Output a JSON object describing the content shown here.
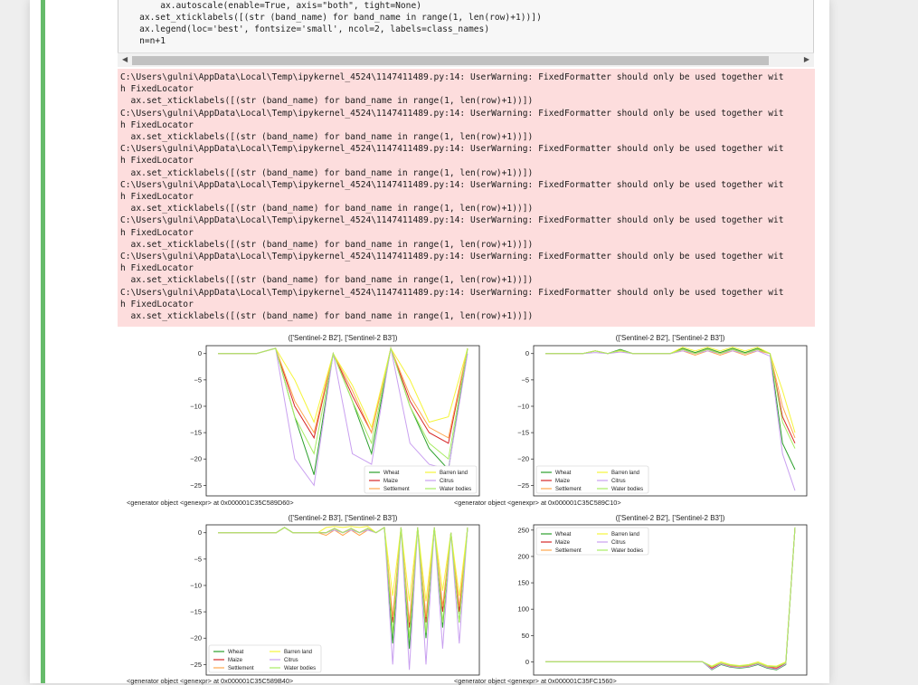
{
  "code": {
    "lines": [
      "        ax.autoscale(enable=True, axis=\"both\", tight=None)",
      "    ax.set_xticklabels([(str (band_name) for band_name in range(1, len(row)+1))])",
      "    ax.legend(loc='best', fontsize='small', ncol=2, labels=class_names)",
      "    n=n+1"
    ]
  },
  "stderr": {
    "warning_line_1": "C:\\Users\\gulni\\AppData\\Local\\Temp\\ipykernel_4524\\1147411489.py:14: UserWarning: FixedFormatter should only be used together wit",
    "warning_line_2": "h FixedLocator",
    "warning_line_3": "  ax.set_xticklabels([(str (band_name) for band_name in range(1, len(row)+1))])",
    "repeat_count": 7
  },
  "colors": {
    "Wheat": "#2ca02c",
    "Maize": "#d62728",
    "Settlement": "#ffa64d",
    "Barren land": "#f5f53b",
    "Citrus": "#c9a0f0",
    "Water bodies": "#a8ec64"
  },
  "chart_data": [
    {
      "type": "line",
      "title": "(['Sentinel-2 B2'], ['Sentinel-2 B3'])",
      "caption": "<generator object <genexpr> at 0x000001C35C589D60>",
      "ylim": [
        -27,
        1.5
      ],
      "yticks": [
        0,
        -5,
        -10,
        -15,
        -20,
        -25
      ],
      "legend": "lower-right",
      "series": [
        {
          "name": "Wheat",
          "values": [
            0,
            0,
            0,
            1,
            -12,
            -23,
            0,
            -9,
            -19,
            1,
            -10,
            -18,
            -22,
            1
          ]
        },
        {
          "name": "Maize",
          "values": [
            0,
            0,
            0,
            1,
            -10,
            -16,
            0,
            -8,
            -15,
            1,
            -9,
            -15,
            -17,
            1
          ]
        },
        {
          "name": "Settlement",
          "values": [
            0,
            0,
            0,
            1,
            -9,
            -15,
            0,
            -7,
            -15,
            1,
            -8,
            -14,
            -16,
            1
          ]
        },
        {
          "name": "Barren land",
          "values": [
            0,
            0,
            0,
            1,
            -5,
            -13,
            0,
            -6,
            -14,
            1,
            -5,
            -13,
            -12,
            1
          ]
        },
        {
          "name": "Citrus",
          "values": [
            0,
            0,
            0,
            1,
            -20,
            -25,
            0,
            -19,
            -21,
            1,
            -17,
            -21,
            -22,
            0
          ]
        },
        {
          "name": "Water bodies",
          "values": [
            0,
            0,
            0,
            1,
            -12,
            -19,
            0,
            -9,
            -17,
            1,
            -10,
            -17,
            -20,
            1
          ]
        }
      ]
    },
    {
      "type": "line",
      "title": "(['Sentinel-2 B2'], ['Sentinel-2 B3'])",
      "caption": "<generator object <genexpr> at 0x000001C35C589C10>",
      "ylim": [
        -27,
        1.5
      ],
      "yticks": [
        0,
        -5,
        -10,
        -15,
        -20,
        -25
      ],
      "legend": "lower-left",
      "series": [
        {
          "name": "Wheat",
          "values": [
            0,
            0,
            0,
            0,
            0.5,
            0,
            0.8,
            0,
            0,
            0,
            0,
            1,
            0.2,
            1,
            0.2,
            1,
            0.2,
            1,
            0,
            -17,
            -22
          ]
        },
        {
          "name": "Maize",
          "values": [
            0,
            0,
            0,
            0,
            0.5,
            0,
            0.6,
            0,
            0,
            0,
            0,
            0.8,
            0,
            0.8,
            0,
            0.8,
            0,
            0.8,
            0,
            -12,
            -17
          ]
        },
        {
          "name": "Settlement",
          "values": [
            0,
            0,
            0,
            0,
            0.5,
            0,
            0.6,
            0,
            0,
            0,
            0,
            0.5,
            -0.3,
            0.5,
            -0.3,
            0.5,
            -0.3,
            0.5,
            0,
            -10,
            -16
          ]
        },
        {
          "name": "Barren land",
          "values": [
            0,
            0,
            0,
            0,
            0.5,
            0,
            0.5,
            0,
            0,
            0,
            0,
            1.2,
            0.5,
            1.2,
            0.5,
            1.2,
            0.5,
            1.2,
            0,
            -7,
            -15
          ]
        },
        {
          "name": "Citrus",
          "values": [
            0,
            0,
            0,
            0,
            0.2,
            0,
            0.3,
            0,
            0,
            0,
            0,
            0.5,
            0,
            0.5,
            0,
            0.5,
            0,
            0.5,
            -0.5,
            -19,
            -26
          ]
        },
        {
          "name": "Water bodies",
          "values": [
            0,
            0,
            0,
            0,
            0.5,
            0,
            0.6,
            0,
            0,
            0,
            0,
            0.8,
            0,
            0.8,
            0,
            0.8,
            0,
            0.8,
            0,
            -13,
            -18
          ]
        }
      ]
    },
    {
      "type": "line",
      "title": "(['Sentinel-2 B3'], ['Sentinel-2 B3'])",
      "caption": "<generator object <genexpr> at 0x000001C35C589B40>",
      "ylim": [
        -27,
        1.5
      ],
      "yticks": [
        0,
        -5,
        -10,
        -15,
        -20,
        -25
      ],
      "legend": "lower-left",
      "series": [
        {
          "name": "Wheat",
          "values": [
            0,
            0,
            0,
            0,
            0,
            0,
            0,
            0,
            1,
            0,
            0,
            0,
            0,
            0,
            0.8,
            0,
            0.8,
            0,
            0.8,
            0,
            1,
            -21,
            1,
            -22,
            1,
            -20,
            1,
            -18,
            0,
            -17,
            1
          ]
        },
        {
          "name": "Maize",
          "values": [
            0,
            0,
            0,
            0,
            0,
            0,
            0,
            0,
            1,
            0,
            0,
            0,
            0,
            0,
            0.8,
            0,
            0.8,
            0,
            0.8,
            0,
            1,
            -17,
            1,
            -18,
            1,
            -17,
            1,
            -15,
            0,
            -15,
            1
          ]
        },
        {
          "name": "Settlement",
          "values": [
            0,
            0,
            0,
            0,
            0,
            0,
            0,
            0,
            1,
            0,
            0,
            0,
            0,
            -0.5,
            0.5,
            -0.5,
            0.5,
            -0.5,
            0.5,
            0,
            1,
            -16,
            1,
            -17,
            1,
            -16,
            1,
            -14,
            0,
            -14,
            1
          ]
        },
        {
          "name": "Barren land",
          "values": [
            0,
            0,
            0,
            0,
            0,
            0,
            0,
            0,
            1,
            0,
            0,
            0,
            0,
            1,
            1.2,
            1,
            1.2,
            1,
            1.2,
            0,
            1,
            -12,
            1,
            -13,
            1,
            -13,
            1,
            -11,
            0,
            -12,
            1
          ]
        },
        {
          "name": "Citrus",
          "values": [
            0,
            0,
            0,
            0,
            0,
            0,
            0,
            0,
            1,
            0,
            0,
            0,
            0,
            0,
            0.5,
            0,
            0.5,
            0,
            0.5,
            0,
            1,
            -25,
            1,
            -26,
            1,
            -25,
            1,
            -22,
            0,
            -21,
            1
          ]
        },
        {
          "name": "Water bodies",
          "values": [
            0,
            0,
            0,
            0,
            0,
            0,
            0,
            0,
            1,
            0,
            0,
            0,
            0,
            0,
            0.8,
            0,
            0.8,
            0,
            0.8,
            0,
            1,
            -19,
            1,
            -20,
            1,
            -19,
            1,
            -17,
            0,
            -17,
            1
          ]
        }
      ]
    },
    {
      "type": "line",
      "title": "(['Sentinel-2 B2'], ['Sentinel-2 B3'])",
      "caption": "<generator object <genexpr> at 0x000001C35FC1560>",
      "ylim": [
        -25,
        260
      ],
      "yticks": [
        250,
        200,
        150,
        100,
        50,
        0
      ],
      "legend": "upper-left",
      "series": [
        {
          "name": "Wheat",
          "values": [
            0,
            0,
            0,
            0,
            0,
            0,
            0,
            0,
            0,
            0,
            0,
            0,
            0,
            0,
            0,
            0,
            0,
            0,
            -15,
            -5,
            -10,
            -12,
            -10,
            -5,
            -12,
            -15,
            -5,
            255
          ]
        },
        {
          "name": "Maize",
          "values": [
            0,
            0,
            0,
            0,
            0,
            0,
            0,
            0,
            0,
            0,
            0,
            0,
            0,
            0,
            0,
            0,
            0,
            0,
            -12,
            -3,
            -8,
            -10,
            -8,
            -3,
            -10,
            -12,
            -3,
            255
          ]
        },
        {
          "name": "Settlement",
          "values": [
            0,
            0,
            0,
            0,
            0,
            0,
            0,
            0,
            0,
            0,
            0,
            0,
            0,
            0,
            0,
            0,
            0,
            0,
            -10,
            -2,
            -7,
            -9,
            -7,
            -2,
            -9,
            -10,
            -2,
            255
          ]
        },
        {
          "name": "Barren land",
          "values": [
            0,
            0,
            0,
            0,
            0,
            0,
            0,
            0,
            0,
            0,
            0,
            0,
            0,
            0,
            0,
            0,
            0,
            0,
            -8,
            0,
            -5,
            -7,
            -5,
            0,
            -7,
            -8,
            0,
            255
          ]
        },
        {
          "name": "Citrus",
          "values": [
            0,
            0,
            0,
            0,
            0,
            0,
            0,
            0,
            0,
            0,
            0,
            0,
            0,
            0,
            0,
            0,
            0,
            0,
            -14,
            -4,
            -9,
            -11,
            -9,
            -4,
            -11,
            -14,
            -4,
            255
          ]
        },
        {
          "name": "Water bodies",
          "values": [
            0,
            0,
            0,
            0,
            0,
            0,
            0,
            0,
            0,
            0,
            0,
            0,
            0,
            0,
            0,
            0,
            0,
            0,
            -9,
            -2,
            -6,
            -8,
            -6,
            -2,
            -8,
            -9,
            -2,
            255
          ]
        }
      ]
    }
  ]
}
